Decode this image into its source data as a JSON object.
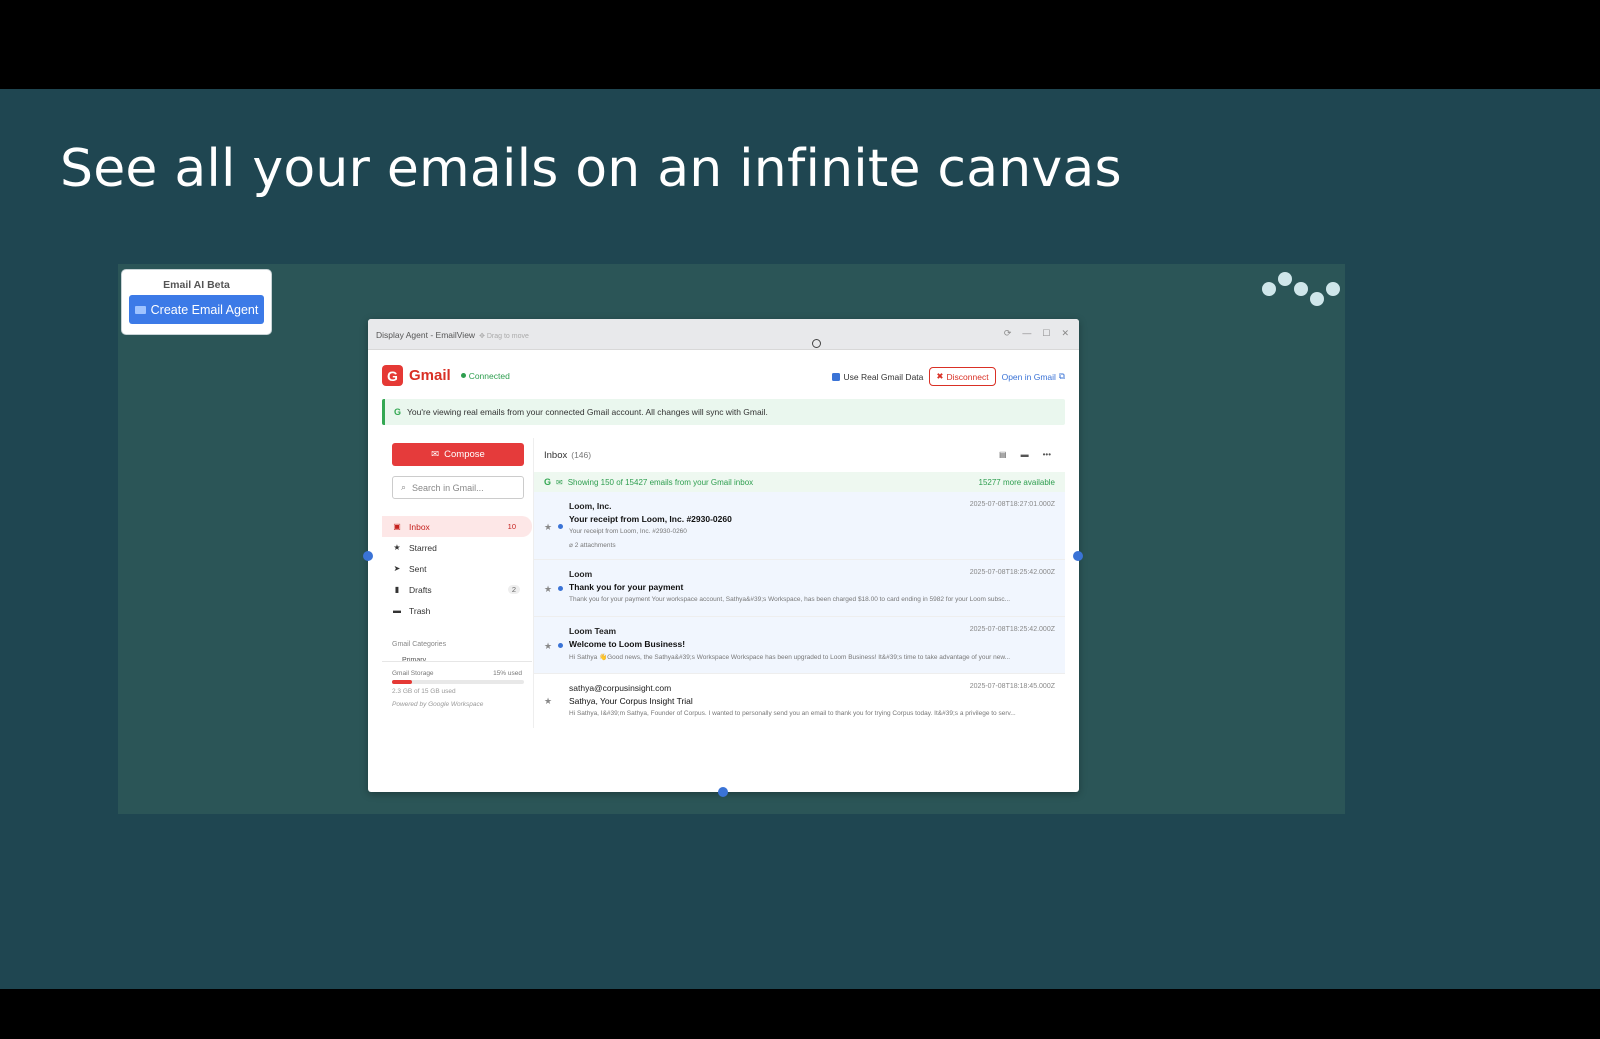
{
  "slide": {
    "headline": "See all your emails on an infinite canvas"
  },
  "agent_panel": {
    "title": "Email AI Beta",
    "button": "Create Email Agent"
  },
  "window": {
    "title": "Display Agent - EmailView",
    "drag_hint": "Drag to move"
  },
  "gmail": {
    "name": "Gmail",
    "logo_letter": "G",
    "status": "Connected",
    "use_real_data": "Use Real Gmail Data",
    "disconnect": "Disconnect",
    "open_in_gmail": "Open in Gmail",
    "notice": "You're viewing real emails from your connected Gmail account. All changes will sync with Gmail."
  },
  "sidebar": {
    "compose": "Compose",
    "search_placeholder": "Search in Gmail...",
    "items": [
      {
        "label": "Inbox",
        "count": "10"
      },
      {
        "label": "Starred",
        "count": ""
      },
      {
        "label": "Sent",
        "count": ""
      },
      {
        "label": "Drafts",
        "count": "2"
      },
      {
        "label": "Trash",
        "count": ""
      }
    ],
    "categories_label": "Gmail Categories",
    "primary_label": "Primary",
    "storage": {
      "label": "Gmail Storage",
      "percent_text": "15% used",
      "percent": 15,
      "used": "2.3 GB of 15 GB used",
      "powered": "Powered by Google Workspace"
    }
  },
  "main": {
    "folder": "Inbox",
    "count": "(146)",
    "banner": "Showing 150 of 15427 emails from your Gmail inbox",
    "more": "15277 more available",
    "emails": [
      {
        "from": "Loom, Inc.",
        "date": "2025-07-08T18:27:01.000Z",
        "subject": "Your receipt from Loom, Inc. #2930-0260",
        "snippet": "Your receipt from Loom, Inc. #2930-0260",
        "attachments": "2 attachments"
      },
      {
        "from": "Loom",
        "date": "2025-07-08T18:25:42.000Z",
        "subject": "Thank you for your payment",
        "snippet": "Thank you for your payment Your workspace account, Sathya&#39;s Workspace, has been charged $18.00 to card ending in 5982 for your Loom subsc..."
      },
      {
        "from": "Loom Team",
        "date": "2025-07-08T18:25:42.000Z",
        "subject": "Welcome to Loom Business!",
        "snippet": "Hi Sathya 👋Good news, the Sathya&#39;s Workspace Workspace has been upgraded to Loom Business! It&#39;s time to take advantage of your new..."
      },
      {
        "from": "sathya@corpusinsight.com",
        "date": "2025-07-08T18:18:45.000Z",
        "subject": "Sathya, Your Corpus Insight Trial",
        "snippet": "Hi Sathya, I&#39;m Sathya, Founder of Corpus. I wanted to personally send you an email to thank you for trying Corpus today. It&#39;s a privilege to serv..."
      }
    ]
  },
  "colors": {
    "slide_bg": "#1f4651",
    "canvas_bg": "#2b5557",
    "accent_blue": "#3c7ae7",
    "gmail_red": "#e53935",
    "connected_green": "#2e9e4f"
  },
  "icons": [
    "gear-icon",
    "mail-icon",
    "search-icon",
    "inbox-icon",
    "star-icon",
    "send-icon",
    "file-icon",
    "trash-icon",
    "archive-icon",
    "more-icon",
    "external-link-icon",
    "paperclip-icon"
  ]
}
